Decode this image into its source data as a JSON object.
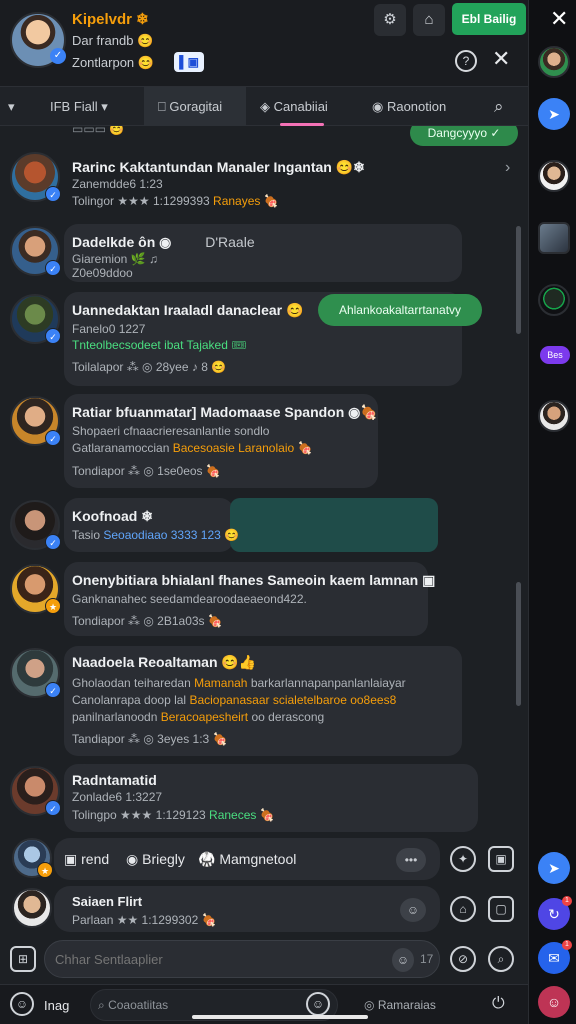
{
  "header": {
    "name": "Kipelvdr ❄",
    "sub1": "Dar frandb 😊",
    "sub2": "Zontlarpon 😊",
    "chip": "▌▣",
    "cta": "Ebl Bailig",
    "help": "?",
    "close": "✕"
  },
  "tabs": [
    {
      "label": "▾"
    },
    {
      "label": "IFB Fiall  ▾"
    },
    {
      "label": "⎕ Goragitai"
    },
    {
      "label": "◈ Canabiiai"
    },
    {
      "label": "◉ Raonotion"
    },
    {
      "label": "⌕"
    }
  ],
  "chat": {
    "top_pill": "Dangcyyyo ✓",
    "items": [
      {
        "title": "Rarinc Kaktantundan Manaler Ingantan 😊❄",
        "line1": "Zanemdde6 1:23",
        "line2": "Tolingor ★★★ 1:1299393",
        "tag": "Ranayes 🍖"
      },
      {
        "title": "Dadelkde ôn ◉",
        "title_extra": "D'Raale",
        "line1": "Giaremion 🌿 ♫",
        "line2": "Z0e09ddoo"
      },
      {
        "title": "Uannedaktan Iraaladl danaclear 😊",
        "pill": "Ahlankoakaltarrtanatvy",
        "line1": "Fanelo0 1227",
        "line2": "Tnteolbecsodeet ibat Tajaked 🎟",
        "line3": "Toilalapor ⁂ ◎ 28yee ♪ 8 😊"
      },
      {
        "title": "Ratiar bfuanmatar] Madomaase Spandon ◉🍖",
        "line1": "Shopaeri cfnaacrieresanlantie sondlo",
        "line2": "Gatlaranamoccian",
        "tag": "Bacesoasie Laranolaio 🍖",
        "line3": "Tondiapor ⁂ ◎ 1se0eos 🍖"
      },
      {
        "title": "Koofnoad ❄",
        "line1": "Tasio",
        "tag": "Seoaodiaao 3333 123",
        "emoji": "😊"
      },
      {
        "title": "Onenybitiara bhialanl fhanes Sameoin kaem lamnan ▣",
        "line1": "Ganknanahec seedamdearoodaeaeond422.",
        "line2": "Tondiapor ⁂ ◎ 2B1a03s 🍖"
      },
      {
        "title": "Naadoela Reoaltaman 😊👍",
        "line1": "Gholaodan teiharedan",
        "tag1": "Mamanah",
        "line1b": "barkarlannapanpanlanlaiayar",
        "line2": "Canolanrapa doop lal",
        "tag2": "Baciopanasaar scialetelbaroe oo8ees8",
        "line3": "panilnarlanoodn",
        "tag3": "Beracoapesheirt",
        "line3b": "oo derascong",
        "line4": "Tandiapor ⁂ ◎ 3eyes 1:3 🍖"
      },
      {
        "title": "Radntamatid",
        "line1": "Zonlade6 1:3227",
        "line2": "Tolingpo ★★★ 1:129123",
        "tag": "Raneces 🍖"
      }
    ]
  },
  "composer": {
    "row1_a": "▣ rend",
    "row1_b": "◉ Briegly",
    "row1_c": "Mamgnetool",
    "row2_title": "Saiaen Flirt",
    "row2_sub": "Parlaan ★★ 1:1299302 🍖",
    "input_placeholder": "Chhar Sentlaaplier",
    "input_hint": "17"
  },
  "footer": {
    "left": "Inag",
    "mid": "Coaoatiitas",
    "right": "Ramaraias"
  },
  "rail": {
    "close": "✕",
    "bubble_label": "Bes"
  },
  "colors": {
    "accent_green": "#22a35a",
    "accent_blue": "#3b82f6",
    "accent_orange": "#f59e0b",
    "bg": "#1d2024"
  }
}
